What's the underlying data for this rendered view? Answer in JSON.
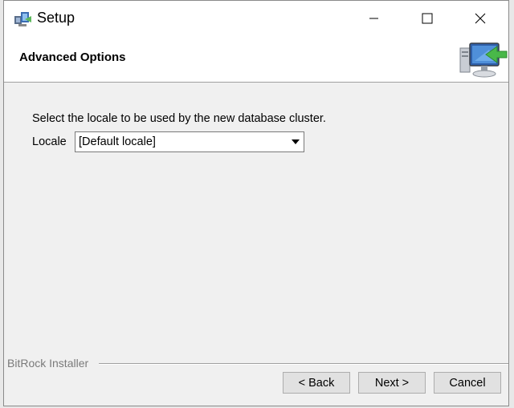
{
  "window": {
    "title": "Setup",
    "controls": {
      "minimize": "minimize-icon",
      "maximize": "maximize-icon",
      "close": "close-icon"
    }
  },
  "header": {
    "title": "Advanced Options",
    "graphic": "computer-install-icon"
  },
  "main": {
    "instruction": "Select the locale to be used by the new database cluster.",
    "locale_label": "Locale",
    "locale_value": "[Default locale]"
  },
  "footer": {
    "brand": "BitRock Installer",
    "back_label": "< Back",
    "next_label": "Next >",
    "cancel_label": "Cancel"
  },
  "colors": {
    "window_background": "#f0f0f0",
    "titlebar_background": "#ffffff",
    "brand_text": "#7a7a7a",
    "button_face": "#e1e1e1"
  }
}
